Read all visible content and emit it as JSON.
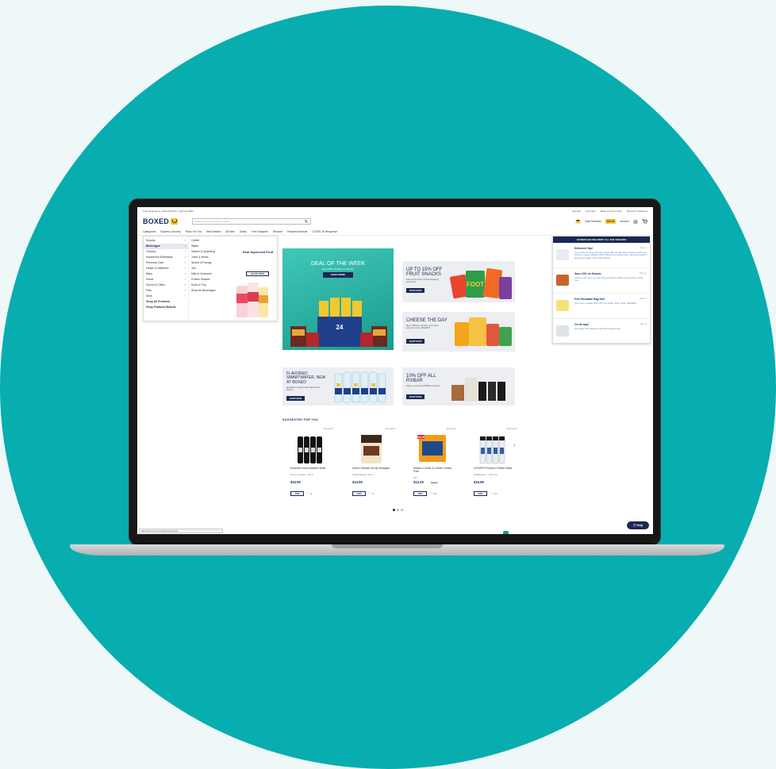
{
  "topbar": {
    "promo": "Free shipping on orders $49.00+ | Express $99+",
    "links": [
      "Reorder",
      "Favorites",
      "Make a Group Order",
      "Boxed for Business"
    ]
  },
  "header": {
    "logo": "BOXED",
    "search_placeholder": "Search for your favorites in bulk",
    "cash_rewards_label": "Cash Rewards",
    "cash_rewards_value": "$10.00",
    "account_label": "Account"
  },
  "nav": {
    "items": [
      "Categories",
      "Express Grocery",
      "Picks For You",
      "Best Sellers",
      "All New",
      "Deals",
      "Free Samples",
      "Reorder",
      "Featured Brands",
      "COVID-19 Response"
    ]
  },
  "mega_menu": {
    "categories": [
      "Snacks",
      "Beverages",
      "Grocery",
      "Household Essentials",
      "Personal Care",
      "Health & Wellness",
      "Baby",
      "Home",
      "School & Office",
      "Pets",
      "Wine",
      "Shop All Products",
      "Shop Featured Brands"
    ],
    "selected_category": "Beverages",
    "tooltip": "Beverages",
    "subcategories": [
      "Coffee",
      "Water",
      "Seltzer & Sparkling",
      "Juice & Mixes",
      "Sports & Energy",
      "Tea",
      "Milk & Creamers",
      "Protein Shakes",
      "Soda & Pop",
      "Shop All Beverages"
    ],
    "promo_title": "Real Squeezed Fruit",
    "promo_button": "SHOP NOW"
  },
  "banners": {
    "deal": {
      "title": "DEAL OF THE WEEK",
      "subtitle": "Save 20% off Nature's Garden",
      "button": "SHOP MORE"
    },
    "fruit_snacks": {
      "title": "UP TO 15% OFF FRUIT SNACKS",
      "subtitle": "Save select favs of fruit Flavored Goodness",
      "button": "SHOP NOW"
    },
    "cheese": {
      "title": "CHEESE THE DAY",
      "subtitle": "Buy 1 Whisps product, get a free second. Code: WHISPS",
      "button": "SHOP NOW"
    },
    "smartwater": {
      "title": "FLAVORED SMARTWATER, NEW AT BOXED",
      "subtitle": "Hydration infused with natural fruit flavors.",
      "button": "SHOP NOW"
    },
    "rxbar": {
      "title": "10% OFF ALL RXBAR",
      "subtitle": "Save on yummy RXBAR products",
      "button": "SHOP NOW"
    }
  },
  "notifications": {
    "header": "SCHEDULED DELIVERY ALL THE UPDATES",
    "items": [
      {
        "title": "Delivered Yay!",
        "when": "May 14",
        "text": "If you think we did a good job, please rate our App. Don't forget to invite your friends to receive Boxed credit! Thanks for shopping here, we look forward to serving you again. View Order Details"
      },
      {
        "title": "Save 10% on Snacks",
        "when": "May 13",
        "text": "Stock up and save on great tasting snacks to satisfy every craving. Shop Now"
      },
      {
        "title": "Free Reusable Bag Set!",
        "when": "May 12",
        "text": "Get 2 free reusable bags with your $100+ order. Code: FREEBAG"
      },
      {
        "title": "On its way!",
        "when": "May 11",
        "text": "Get ready! Your shipment has left the facility and"
      }
    ]
  },
  "recommendations": {
    "title": "SUGGESTED FOR YOU",
    "sponsored": "Sponsored",
    "add_label": "ADD",
    "products": [
      {
        "name": "Essentia Ionized Alkaline Water",
        "size": "9.5 pH or Higher • 16.9 fl",
        "price": "$24.99",
        "likes": "4k"
      },
      {
        "name": "Duke's Smoked Shorty Sausages",
        "size": "Original Recipe • 16 oz",
        "price": "$14.99",
        "likes": "1k"
      },
      {
        "name": "Nabisco Cookie & Cracker Variety Pack",
        "size": "40 ct",
        "price": "$13.29",
        "sale_price": "$15.99",
        "likes": "8.3k",
        "badge": "SALE"
      },
      {
        "name": "LIFEWTR Premium Purified Water",
        "size": "pH Balanced... • 16.9 fl oz",
        "price": "$16.99",
        "likes": "1.4k"
      }
    ]
  },
  "help_label": "Help",
  "status_url": "https://www.boxed.com/category/beverages",
  "colors": {
    "brand_navy": "#1a2952",
    "brand_yellow": "#f3c82f",
    "teal": "#08adaf",
    "deal_teal": "#2bb3a5"
  }
}
